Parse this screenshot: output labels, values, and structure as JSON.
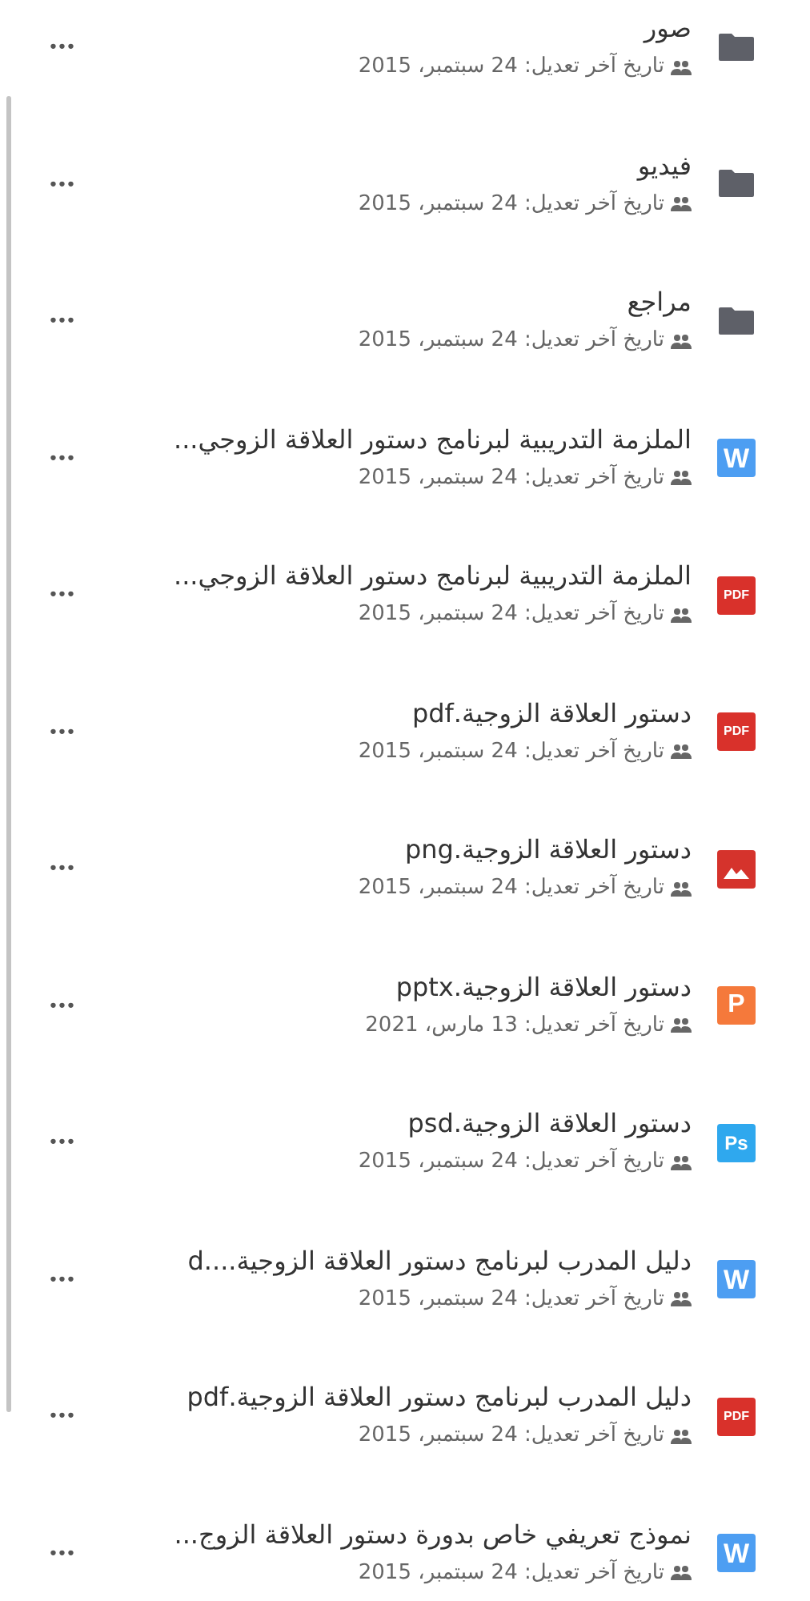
{
  "files": [
    {
      "kind": "folder",
      "name": "صور",
      "meta": "تاريخ آخر تعديل: 24 سبتمبر، 2015",
      "more": "•••"
    },
    {
      "kind": "folder",
      "name": "فيديو",
      "meta": "تاريخ آخر تعديل: 24 سبتمبر، 2015",
      "more": "•••"
    },
    {
      "kind": "folder",
      "name": "مراجع",
      "meta": "تاريخ آخر تعديل: 24 سبتمبر، 2015",
      "more": "•••"
    },
    {
      "kind": "word",
      "badge": "W",
      "name": "الملزمة التدريبية لبرنامج دستور العلاقة الزوجي...",
      "meta": "تاريخ آخر تعديل: 24 سبتمبر، 2015",
      "more": "•••"
    },
    {
      "kind": "pdf",
      "badge": "PDF",
      "name": "الملزمة التدريبية لبرنامج دستور العلاقة الزوجي...",
      "meta": "تاريخ آخر تعديل: 24 سبتمبر، 2015",
      "more": "•••"
    },
    {
      "kind": "pdf",
      "badge": "PDF",
      "name": "دستور العلاقة الزوجية.pdf",
      "meta": "تاريخ آخر تعديل: 24 سبتمبر، 2015",
      "more": "•••"
    },
    {
      "kind": "image",
      "name": "دستور العلاقة الزوجية.png",
      "meta": "تاريخ آخر تعديل: 24 سبتمبر، 2015",
      "more": "•••"
    },
    {
      "kind": "powerpoint",
      "badge": "P",
      "name": "دستور العلاقة الزوجية.pptx",
      "meta": "تاريخ آخر تعديل: 13 مارس، 2021",
      "more": "•••"
    },
    {
      "kind": "photoshop",
      "badge": "Ps",
      "name": "دستور العلاقة الزوجية.psd",
      "meta": "تاريخ آخر تعديل: 24 سبتمبر، 2015",
      "more": "•••"
    },
    {
      "kind": "word",
      "badge": "W",
      "name": "دليل المدرب لبرنامج دستور العلاقة الزوجية....d",
      "meta": "تاريخ آخر تعديل: 24 سبتمبر، 2015",
      "more": "•••"
    },
    {
      "kind": "pdf",
      "badge": "PDF",
      "name": "دليل المدرب لبرنامج دستور العلاقة الزوجية.pdf",
      "meta": "تاريخ آخر تعديل: 24 سبتمبر، 2015",
      "more": "•••"
    },
    {
      "kind": "word",
      "badge": "W",
      "name": "نموذج تعريفي خاص بدورة دستور العلاقة الزوج...",
      "meta": "تاريخ آخر تعديل: 24 سبتمبر، 2015",
      "more": "•••"
    }
  ]
}
